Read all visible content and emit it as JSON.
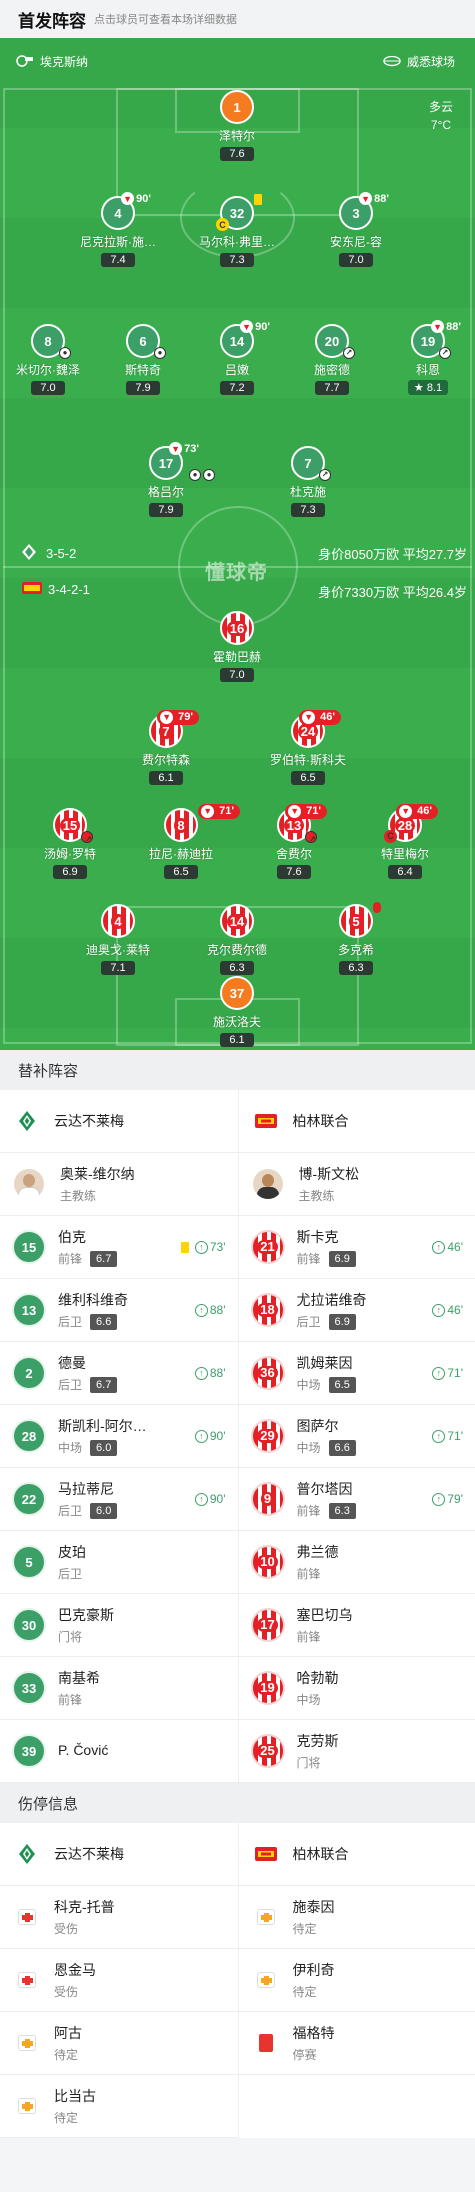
{
  "header": {
    "title": "首发阵容",
    "subtitle": "点击球员可查看本场详细数据"
  },
  "pitch": {
    "home_team": "埃克斯纳",
    "away_team": "威悉球场",
    "weather": "多云",
    "temperature": "7°C",
    "home_formation": "3-5-2",
    "away_formation": "3-4-2-1",
    "home_value": "身价8050万欧 平均27.7岁",
    "away_value": "身价7330万欧 平均26.4岁",
    "watermark": "懂球帝"
  },
  "home_players": [
    {
      "num": "1",
      "name": "泽特尔",
      "rating": "7.6"
    },
    {
      "num": "4",
      "name": "尼克拉斯·施…",
      "rating": "7.4",
      "sub_min": "90'"
    },
    {
      "num": "32",
      "name": "马尔科·弗里…",
      "rating": "7.3"
    },
    {
      "num": "3",
      "name": "安东尼-容",
      "rating": "7.0",
      "sub_min": "88'"
    },
    {
      "num": "8",
      "name": "米切尔·魏泽",
      "rating": "7.0"
    },
    {
      "num": "6",
      "name": "斯特奇",
      "rating": "7.9"
    },
    {
      "num": "14",
      "name": "吕嫩",
      "rating": "7.2",
      "sub_min": "90'"
    },
    {
      "num": "20",
      "name": "施密德",
      "rating": "7.7"
    },
    {
      "num": "19",
      "name": "科恩",
      "rating": "8.1",
      "sub_min": "88'"
    },
    {
      "num": "17",
      "name": "格吕尔",
      "rating": "7.9",
      "sub_min": "73'"
    },
    {
      "num": "7",
      "name": "杜克施",
      "rating": "7.3"
    }
  ],
  "away_players": [
    {
      "num": "16",
      "name": "霍勒巴赫",
      "rating": "7.0"
    },
    {
      "num": "7",
      "name": "费尔特森",
      "rating": "6.1",
      "sub_min": "79'"
    },
    {
      "num": "24",
      "name": "罗伯特·斯科夫",
      "rating": "6.5",
      "sub_min": "46'"
    },
    {
      "num": "15",
      "name": "汤姆·罗特",
      "rating": "6.9"
    },
    {
      "num": "8",
      "name": "拉尼·赫迪拉",
      "rating": "6.5",
      "sub_min": "71'"
    },
    {
      "num": "13",
      "name": "舍费尔",
      "rating": "7.6",
      "sub_min": "71'"
    },
    {
      "num": "28",
      "name": "特里梅尔",
      "rating": "6.4",
      "sub_min": "46'"
    },
    {
      "num": "4",
      "name": "迪奥戈·莱特",
      "rating": "7.1"
    },
    {
      "num": "14",
      "name": "克尔费尔德",
      "rating": "6.3"
    },
    {
      "num": "5",
      "name": "多克希",
      "rating": "6.3"
    },
    {
      "num": "37",
      "name": "施沃洛夫",
      "rating": "6.1"
    }
  ],
  "subs": {
    "title": "替补阵容",
    "home_team": "云达不莱梅",
    "away_team": "柏林联合",
    "home_coach": {
      "name": "奥莱-维尔纳",
      "role": "主教练"
    },
    "away_coach": {
      "name": "博-斯文松",
      "role": "主教练"
    },
    "home": [
      {
        "num": "15",
        "name": "伯克",
        "pos": "前锋",
        "rating": "6.7",
        "min": "73'",
        "card": "yellow"
      },
      {
        "num": "13",
        "name": "维利科维奇",
        "pos": "后卫",
        "rating": "6.6",
        "min": "88'"
      },
      {
        "num": "2",
        "name": "德曼",
        "pos": "后卫",
        "rating": "6.7",
        "min": "88'"
      },
      {
        "num": "28",
        "name": "斯凯利-阿尔…",
        "pos": "中场",
        "rating": "6.0",
        "min": "90'"
      },
      {
        "num": "22",
        "name": "马拉蒂尼",
        "pos": "后卫",
        "rating": "6.0",
        "min": "90'"
      },
      {
        "num": "5",
        "name": "皮珀",
        "pos": "后卫"
      },
      {
        "num": "30",
        "name": "巴克豪斯",
        "pos": "门将"
      },
      {
        "num": "33",
        "name": "南基希",
        "pos": "前锋"
      },
      {
        "num": "39",
        "name": "P. Čović",
        "pos": ""
      }
    ],
    "away": [
      {
        "num": "21",
        "name": "斯卡克",
        "pos": "前锋",
        "rating": "6.9",
        "min": "46'"
      },
      {
        "num": "18",
        "name": "尤拉诺维奇",
        "pos": "后卫",
        "rating": "6.9",
        "min": "46'"
      },
      {
        "num": "36",
        "name": "凯姆莱因",
        "pos": "中场",
        "rating": "6.5",
        "min": "71'"
      },
      {
        "num": "29",
        "name": "图萨尔",
        "pos": "中场",
        "rating": "6.6",
        "min": "71'"
      },
      {
        "num": "9",
        "name": "普尔塔因",
        "pos": "前锋",
        "rating": "6.3",
        "min": "79'"
      },
      {
        "num": "10",
        "name": "弗兰德",
        "pos": "前锋"
      },
      {
        "num": "17",
        "name": "塞巴切乌",
        "pos": "前锋"
      },
      {
        "num": "19",
        "name": "哈勃勒",
        "pos": "中场"
      },
      {
        "num": "25",
        "name": "克劳斯",
        "pos": "门将"
      }
    ]
  },
  "injuries": {
    "title": "伤停信息",
    "home_team": "云达不莱梅",
    "away_team": "柏林联合",
    "home": [
      {
        "name": "科克-托普",
        "status": "受伤",
        "type": "injury"
      },
      {
        "name": "恩金马",
        "status": "受伤",
        "type": "injury"
      },
      {
        "name": "阿古",
        "status": "待定",
        "type": "doubt"
      },
      {
        "name": "比当古",
        "status": "待定",
        "type": "doubt"
      }
    ],
    "away": [
      {
        "name": "施泰因",
        "status": "待定",
        "type": "doubt"
      },
      {
        "name": "伊利奇",
        "status": "待定",
        "type": "doubt"
      },
      {
        "name": "福格特",
        "status": "停赛",
        "type": "suspended"
      }
    ]
  },
  "colors": {
    "pitch": "#3aae4d",
    "home": "#3c9f68",
    "away": "#e32025",
    "gk": "#f47b20"
  },
  "icons": [
    "werder-logo",
    "union-logo",
    "sub-icon",
    "yellow-card-icon",
    "ball-icon",
    "captain-icon",
    "injury-icon",
    "doubt-icon",
    "red-card-icon"
  ]
}
